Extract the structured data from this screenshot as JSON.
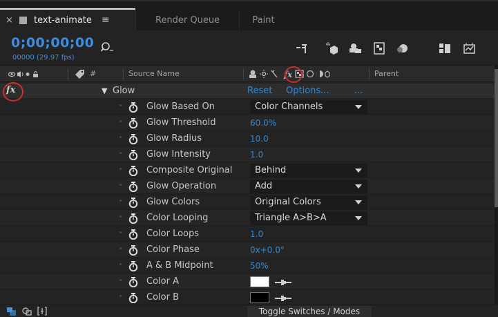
{
  "tabs": {
    "active_label": "text-animate",
    "close_glyph": "×",
    "menu_glyph": "≡",
    "render_queue": "Render Queue",
    "paint": "Paint"
  },
  "toolbar": {
    "timecode": "0;00;00;00",
    "fps": "00000 (29.97 fps)",
    "search_icon": "search-icon"
  },
  "columns": {
    "hash": "#",
    "source_name": "Source Name",
    "parent": "Parent"
  },
  "effect": {
    "fx_label": "fx",
    "name": "Glow",
    "twirl_glyph": "▼",
    "reset": "Reset",
    "options": "Options...",
    "ellipsis": "..."
  },
  "properties": [
    {
      "name": "Glow Based On",
      "kind": "dropdown",
      "value": "Color Channels"
    },
    {
      "name": "Glow Threshold",
      "kind": "number",
      "value": "60.0%"
    },
    {
      "name": "Glow Radius",
      "kind": "number",
      "value": "10.0"
    },
    {
      "name": "Glow Intensity",
      "kind": "number",
      "value": "1.0"
    },
    {
      "name": "Composite Original",
      "kind": "dropdown",
      "value": "Behind"
    },
    {
      "name": "Glow Operation",
      "kind": "dropdown",
      "value": "Add"
    },
    {
      "name": "Glow Colors",
      "kind": "dropdown",
      "value": "Original Colors"
    },
    {
      "name": "Color Looping",
      "kind": "dropdown",
      "value": "Triangle A>B>A"
    },
    {
      "name": "Color Loops",
      "kind": "number",
      "value": "1.0"
    },
    {
      "name": "Color Phase",
      "kind": "number",
      "value": "0x+0.0°"
    },
    {
      "name": "A & B Midpoint",
      "kind": "number",
      "value": "50%"
    },
    {
      "name": "Color A",
      "kind": "color",
      "value": "#ffffff"
    },
    {
      "name": "Color B",
      "kind": "color",
      "value": "#000000"
    }
  ],
  "bottom": {
    "toggle_label": "Toggle Switches / Modes"
  },
  "colors": {
    "accent_blue": "#2f8ad6",
    "timecode_blue": "#3d8ee0",
    "annotation_red": "#c83030"
  }
}
